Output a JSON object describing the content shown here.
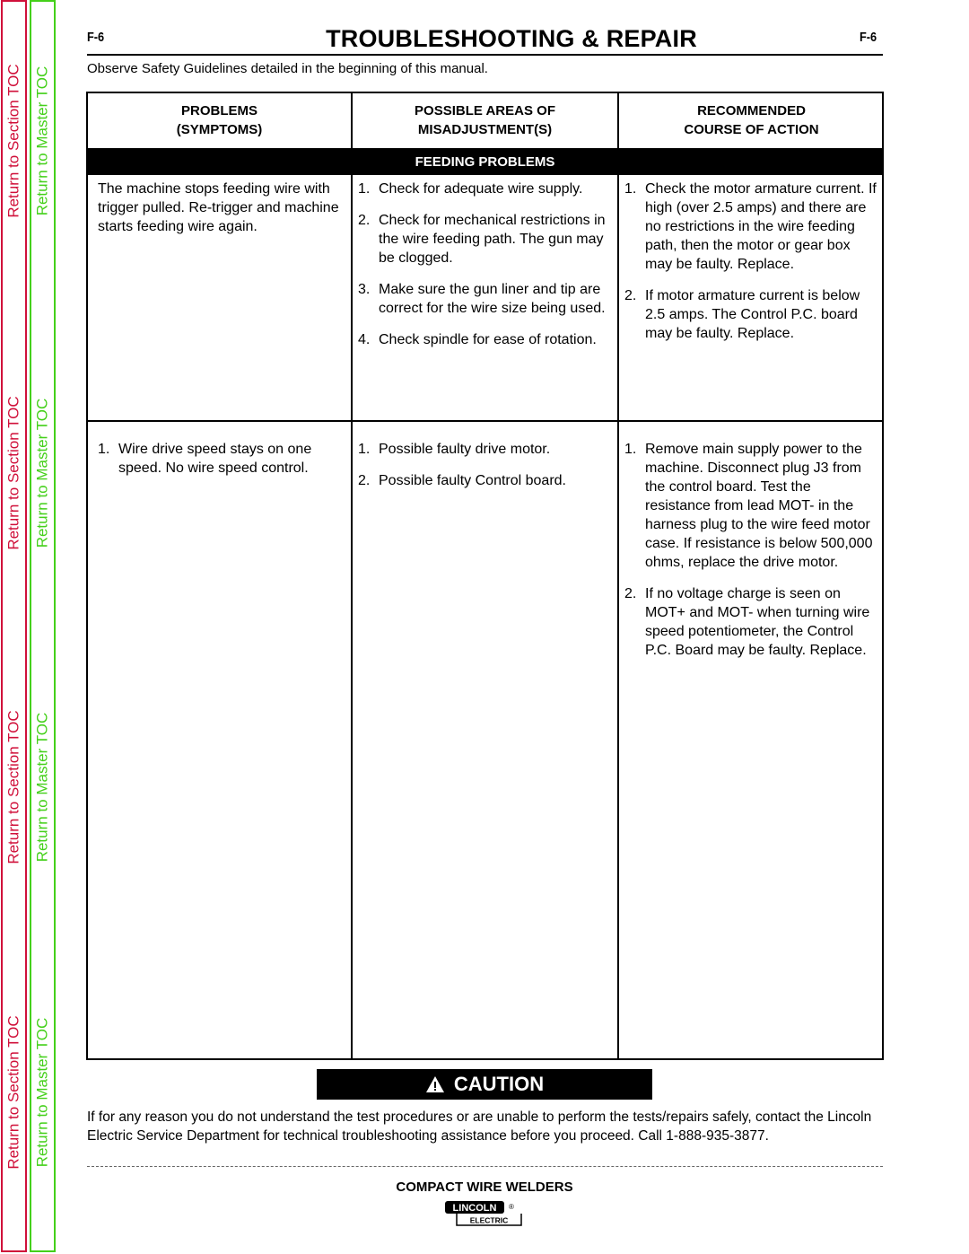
{
  "side_tabs": {
    "section_label": "Return to Section TOC",
    "master_label": "Return to Master TOC",
    "section_color": "#d0103a",
    "master_color": "#44d01a"
  },
  "header": {
    "page_number_left": "F-6",
    "page_number_right": "F-6",
    "title": "TROUBLESHOOTING & REPAIR",
    "safety_note": "Observe Safety Guidelines detailed in the beginning of this manual."
  },
  "table": {
    "columns": [
      {
        "line1": "PROBLEMS",
        "line2": "(SYMPTOMS)"
      },
      {
        "line1": "POSSIBLE AREAS OF",
        "line2": "MISADJUSTMENT(S)"
      },
      {
        "line1": "RECOMMENDED",
        "line2": "COURSE OF ACTION"
      }
    ],
    "section_title": "FEEDING PROBLEMS",
    "rows": [
      {
        "symptom": "The machine stops feeding wire with trigger pulled. Re-trigger and machine starts feeding wire again.",
        "areas": [
          {
            "num": "1.",
            "text": "Check for adequate wire supply."
          },
          {
            "num": "2.",
            "text": "Check for mechanical restrictions in the wire feeding path. The gun may be clogged."
          },
          {
            "num": "3.",
            "text": "Make sure the gun liner and tip are correct for the wire size being used."
          },
          {
            "num": "4.",
            "text": "Check spindle for ease of rotation."
          }
        ],
        "actions": [
          {
            "num": "1.",
            "text": "Check the motor armature current. If high (over 2.5 amps) and there are no restrictions in the wire feeding path, then the motor or gear box may be faulty. Replace."
          },
          {
            "num": "2.",
            "text": "If motor armature current is below 2.5 amps. The Control P.C. board may be faulty. Replace."
          }
        ]
      },
      {
        "symptom_num": "1.",
        "symptom": "Wire drive speed stays on one speed. No wire speed control.",
        "areas": [
          {
            "num": "1.",
            "text": "Possible faulty drive motor."
          },
          {
            "num": "2.",
            "text": "Possible faulty Control board."
          }
        ],
        "actions": [
          {
            "num": "1.",
            "text": "Remove main supply power to the machine. Disconnect plug J3 from the control board. Test the resistance from lead MOT- in the harness plug to the wire feed motor case. If resistance is below 500,000 ohms, replace the drive motor."
          },
          {
            "num": "2.",
            "text": "If no voltage charge is seen on MOT+ and MOT- when turning wire speed potentiometer, the Control P.C. Board may be faulty. Replace."
          }
        ]
      }
    ]
  },
  "caution": {
    "icon": "warning-triangle-icon",
    "label": "CAUTION",
    "text": "If for any reason you do not understand the test procedures or are unable to perform the tests/repairs safely, contact the Lincoln Electric Service Department for technical troubleshooting assistance before you proceed. Call 1-888-935-3877."
  },
  "footer": {
    "title": "COMPACT WIRE WELDERS",
    "logo_top": "LINCOLN",
    "logo_bottom": "ELECTRIC",
    "logo_mark": "®"
  }
}
